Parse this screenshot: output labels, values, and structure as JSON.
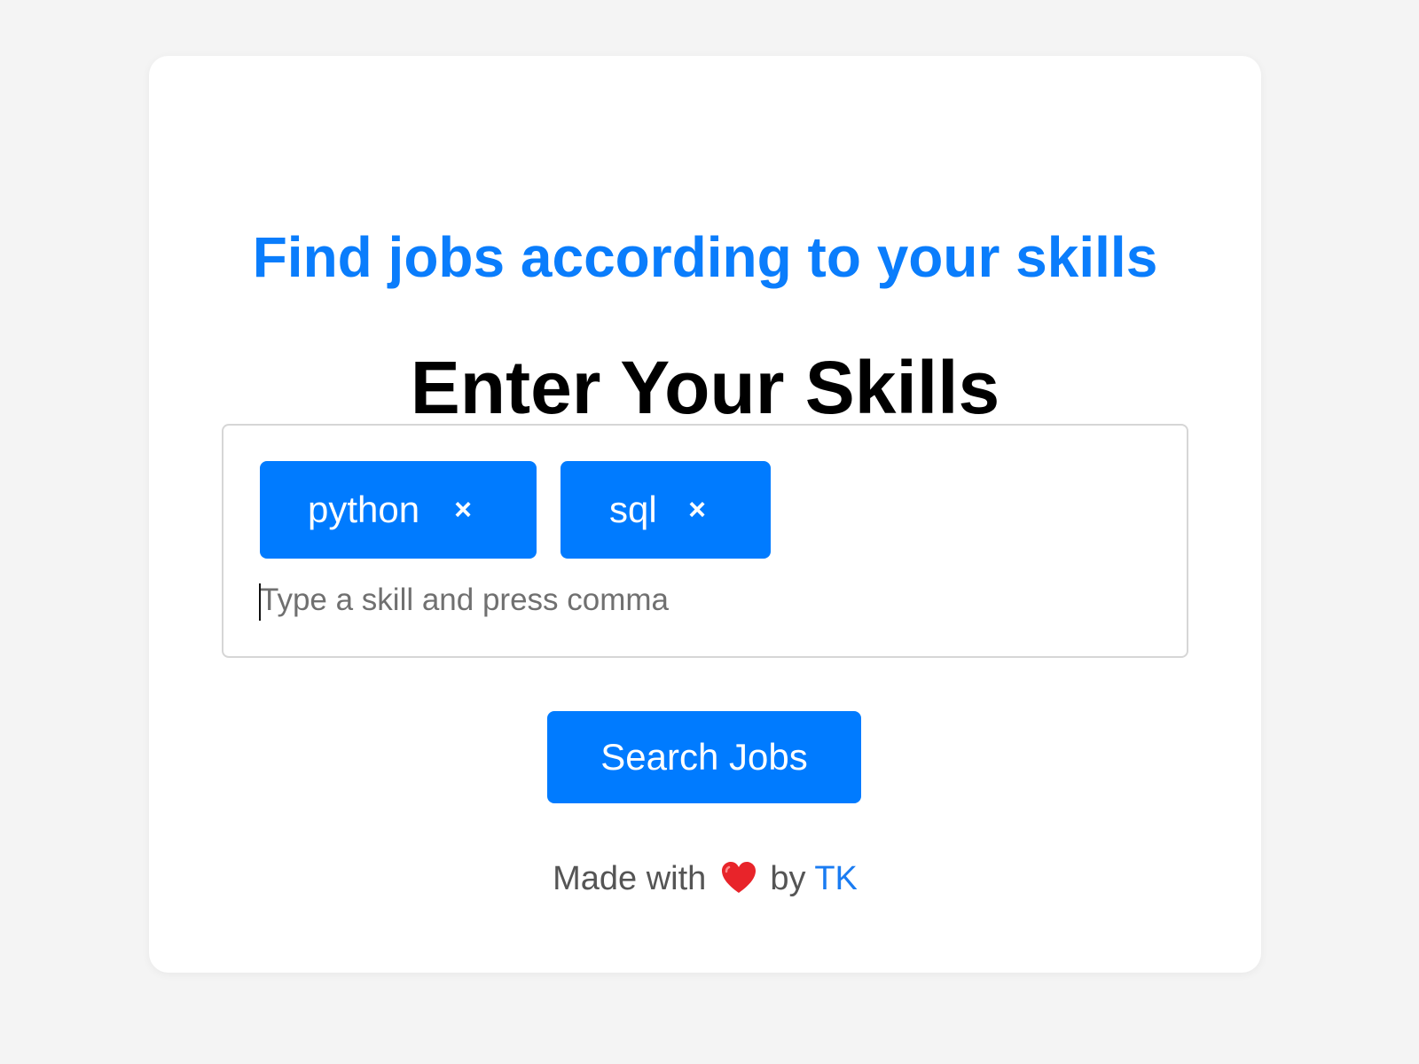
{
  "headline": "Find jobs according to your skills",
  "page_title": "Enter Your Skills",
  "skills": {
    "tags": [
      {
        "label": "python",
        "remove": "×"
      },
      {
        "label": "sql",
        "remove": "×"
      }
    ],
    "input_value": "",
    "placeholder": "Type a skill and press comma"
  },
  "search_button_label": "Search Jobs",
  "footer": {
    "made_with": "Made with",
    "heart_icon": "heart-icon",
    "by": "by",
    "author": "TK"
  },
  "colors": {
    "accent": "#007bff",
    "headline": "#0a7dfc",
    "background": "#f4f4f4",
    "heart": "#e8242a"
  }
}
